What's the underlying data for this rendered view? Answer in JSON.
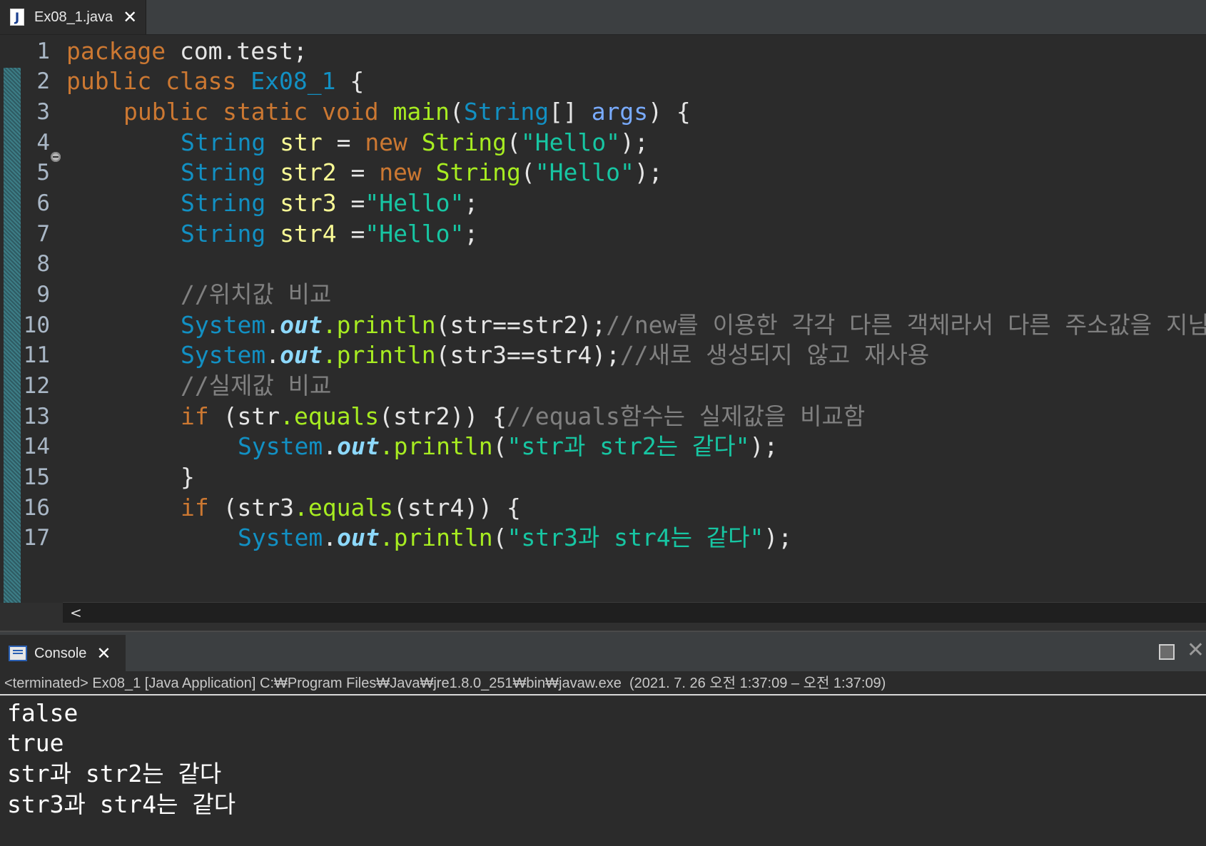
{
  "editor_tab": {
    "icon": "java-file-icon",
    "icon_glyph": "J",
    "label": "Ex08_1.java",
    "close": "✕"
  },
  "line_numbers": [
    "1",
    "2",
    "3",
    "4",
    "5",
    "6",
    "7",
    "8",
    "9",
    "10",
    "11",
    "12",
    "13",
    "14",
    "15",
    "16",
    "17"
  ],
  "code": {
    "l1": {
      "kw": "package",
      "rest": " com.test;"
    },
    "l2": {
      "kw": "public class",
      "cls": "Ex08_1",
      "rest": " {"
    },
    "l3": {
      "kw": "public static void",
      "fn": "main",
      "p1": "(",
      "ty": "String",
      "p2": "[] ",
      "arg": "args",
      "p3": ") {"
    },
    "l4": {
      "ty": "String",
      "id": "str",
      "p1": " = ",
      "kw": "new",
      "fn": "String",
      "p2": "(",
      "str": "\"Hello\"",
      "p3": ");"
    },
    "l5": {
      "ty": "String",
      "id": "str2",
      "p1": " = ",
      "kw": "new",
      "fn": "String",
      "p2": "(",
      "str": "\"Hello\"",
      "p3": ");"
    },
    "l6": {
      "ty": "String",
      "id": "str3",
      "p1": " =",
      "str": "\"Hello\"",
      "p3": ";"
    },
    "l7": {
      "ty": "String",
      "id": "str4",
      "p1": " =",
      "str": "\"Hello\"",
      "p3": ";"
    },
    "l9": {
      "cm": "//위치값 비교"
    },
    "l10": {
      "cls": "System",
      "dot": ".",
      "fld": "out",
      "mt": ".println",
      "p1": "(str==str2);",
      "cm": "//new를 이용한 각각 다른 객체라서 다른 주소값을 지님."
    },
    "l11": {
      "cls": "System",
      "dot": ".",
      "fld": "out",
      "mt": ".println",
      "p1": "(str3==str4);",
      "cm": "//새로 생성되지 않고 재사용"
    },
    "l12": {
      "cm": "//실제값 비교"
    },
    "l13": {
      "kw": "if",
      "p1": " (str",
      "mt": ".equals",
      "p2": "(str2)) {",
      "cm": "//equals함수는 실제값을 비교함"
    },
    "l14": {
      "cls": "System",
      "dot": ".",
      "fld": "out",
      "mt": ".println",
      "p1": "(",
      "str": "\"str과 str2는 같다\"",
      "p2": ");"
    },
    "l15": {
      "p": "}"
    },
    "l16": {
      "kw": "if",
      "p1": " (str3",
      "mt": ".equals",
      "p2": "(str4)) {"
    },
    "l17": {
      "cls": "System",
      "dot": ".",
      "fld": "out",
      "mt": ".println",
      "p1": "(",
      "str": "\"str3과 str4는 같다\"",
      "p2": ");"
    }
  },
  "scroll_arrow": "<",
  "console": {
    "icon": "console-icon",
    "label": "Console",
    "close": "✕",
    "status": "<terminated> Ex08_1 [Java Application] C:₩Program Files₩Java₩jre1.8.0_251₩bin₩javaw.exe  (2021. 7. 26 오전 1:37:09 – 오전 1:37:09)",
    "output": [
      "false",
      "true",
      "str과 str2는 같다",
      "str3과 str4는 같다"
    ]
  }
}
